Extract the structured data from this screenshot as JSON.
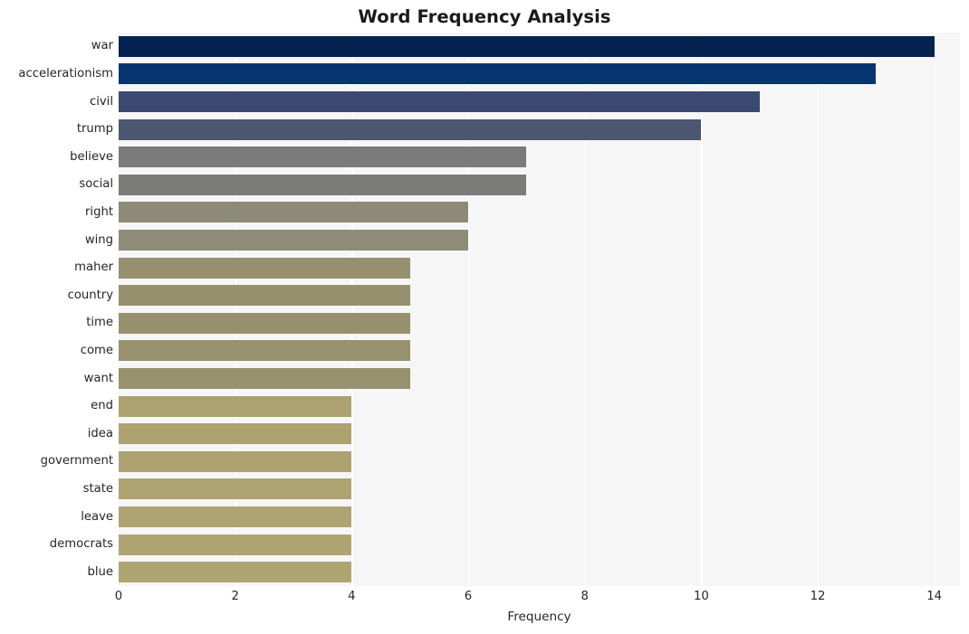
{
  "chart_data": {
    "type": "bar",
    "orientation": "horizontal",
    "title": "Word Frequency Analysis",
    "xlabel": "Frequency",
    "ylabel": "",
    "categories": [
      "war",
      "accelerationism",
      "civil",
      "trump",
      "believe",
      "social",
      "right",
      "wing",
      "maher",
      "country",
      "time",
      "come",
      "want",
      "end",
      "idea",
      "government",
      "state",
      "leave",
      "democrats",
      "blue"
    ],
    "values": [
      14,
      13,
      11,
      10,
      7,
      7,
      6,
      6,
      5,
      5,
      5,
      5,
      5,
      4,
      4,
      4,
      4,
      4,
      4,
      4
    ],
    "bar_colors": [
      "#042350",
      "#04356e",
      "#3c4a72",
      "#4d5671",
      "#7a7a78",
      "#7b7b79",
      "#8d8a77",
      "#8e8b78",
      "#968f70",
      "#97906f",
      "#97906f",
      "#98916e",
      "#98916e",
      "#aca271",
      "#ada371",
      "#ada371",
      "#aea472",
      "#aea472",
      "#afa572",
      "#afa572"
    ],
    "xlim": [
      0,
      14.44
    ],
    "xticks": [
      0,
      2,
      4,
      6,
      8,
      10,
      12,
      14
    ],
    "xticklabels": [
      "0",
      "2",
      "4",
      "6",
      "8",
      "10",
      "12",
      "14"
    ],
    "grid": true,
    "grid_axis": "x",
    "grid_color": "#ffffff",
    "plot_background": "#f6f6f7",
    "figure_background": "#ffffff",
    "legend": null
  }
}
